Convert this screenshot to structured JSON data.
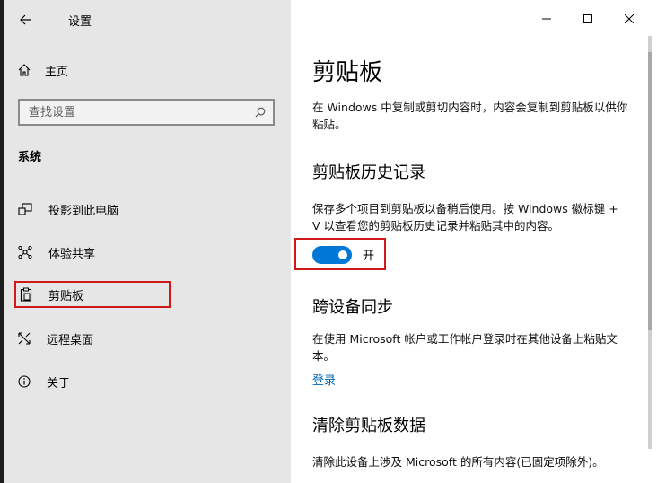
{
  "app": {
    "title": "设置"
  },
  "sidebar": {
    "home_label": "主页",
    "search_placeholder": "查找设置",
    "section": "系统",
    "items": [
      {
        "label": "投影到此电脑",
        "icon": "project-icon"
      },
      {
        "label": "体验共享",
        "icon": "share-icon"
      },
      {
        "label": "剪贴板",
        "icon": "clipboard-icon",
        "selected": true
      },
      {
        "label": "远程桌面",
        "icon": "remote-desktop-icon"
      },
      {
        "label": "关于",
        "icon": "info-icon"
      }
    ]
  },
  "main": {
    "title": "剪贴板",
    "intro": "在 Windows 中复制或剪切内容时，内容会复制到剪贴板以供你粘贴。",
    "history": {
      "heading": "剪贴板历史记录",
      "desc": "保存多个项目到剪贴板以备稍后使用。按 Windows 徽标键 + V 以查看您的剪贴板历史记录并粘贴其中的内容。",
      "toggle_state": "开",
      "toggle_on": true
    },
    "sync": {
      "heading": "跨设备同步",
      "desc": "在使用 Microsoft 帐户或工作帐户登录时在其他设备上粘贴文本。",
      "link": "登录"
    },
    "clear": {
      "heading": "清除剪贴板数据",
      "desc": "清除此设备上涉及 Microsoft 的所有内容(已固定项除外)。"
    }
  },
  "colors": {
    "accent": "#0078d7",
    "highlight": "#d01a1a",
    "link": "#0063b1",
    "sidebar_bg": "#e6e6e6"
  }
}
